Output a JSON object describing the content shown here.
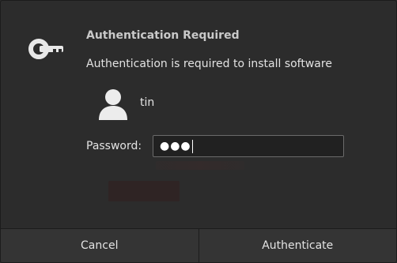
{
  "dialog": {
    "title": "Authentication Required",
    "message": "Authentication is required to install software",
    "icon": "key-icon"
  },
  "user": {
    "avatar_icon": "user-avatar-icon",
    "name": "tin"
  },
  "password": {
    "label": "Password:",
    "masked_value": "●●●"
  },
  "buttons": {
    "cancel": "Cancel",
    "authenticate": "Authenticate"
  },
  "colors": {
    "background": "#2c2c2c",
    "text": "#e3e3e3",
    "input_border": "#6b6b6b"
  }
}
